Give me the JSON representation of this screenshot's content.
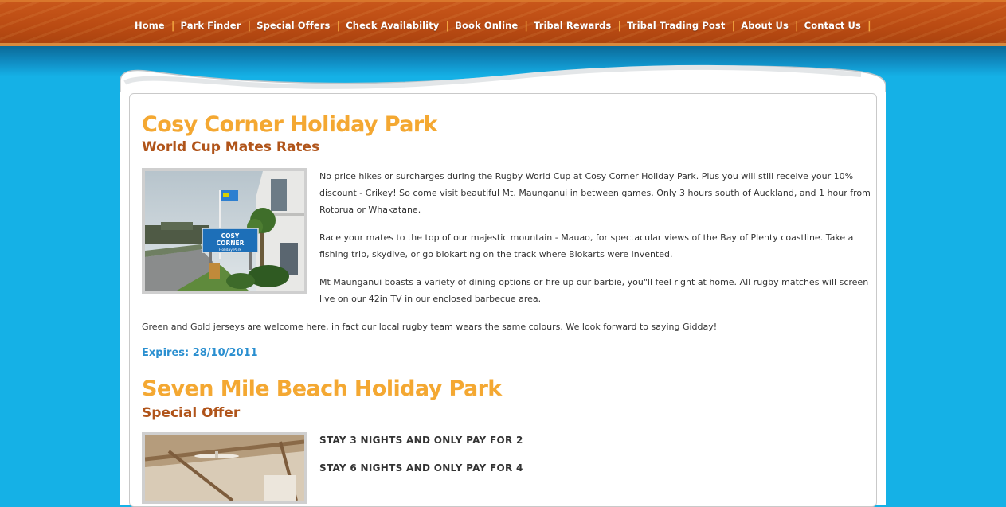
{
  "nav": {
    "items": [
      "Home",
      "Park Finder",
      "Special Offers",
      "Check Availability",
      "Book Online",
      "Tribal Rewards",
      "Tribal Trading Post",
      "About Us",
      "Contact Us"
    ],
    "separator": "|"
  },
  "offers": [
    {
      "title": "Cosy Corner Holiday Park",
      "subtitle": "World Cup Mates Rates",
      "sign_text_1": "COSY",
      "sign_text_2": "CORNER",
      "sign_text_3": "Holiday Park",
      "paragraphs": [
        "No price hikes or surcharges during the Rugby World Cup at Cosy Corner Holiday Park.  Plus you will still receive your 10% discount - Crikey!  So come visit beautiful Mt. Maunganui in between games.  Only 3 hours south of Auckland, and 1 hour from Rotorua or Whakatane.",
        "Race your mates to the top of our majestic mountain - Mauao, for spectacular views of the Bay of Plenty coastline.  Take a fishing trip, skydive, or go blokarting on the track where Blokarts were invented.",
        "Mt Maunganui boasts a variety of dining options or fire up our barbie, you\"ll feel right at home.  All rugby matches will screen live on our 42in TV in our enclosed barbecue area.",
        "Green and Gold jerseys are welcome here, in fact our local rugby team wears the same colours.  We look forward to saying Gidday!"
      ],
      "expires": "Expires: 28/10/2011"
    },
    {
      "title": "Seven Mile Beach Holiday Park",
      "subtitle": "Special Offer",
      "lines": [
        "STAY 3 NIGHTS AND ONLY PAY FOR 2",
        "STAY 6 NIGHTS AND ONLY PAY FOR 4"
      ]
    }
  ],
  "colors": {
    "background": "#15b1e6",
    "nav_orange": "#b84a12",
    "title_orange": "#f4a832",
    "subtitle_brown": "#b0541a",
    "expires_blue": "#2a8fd0"
  }
}
